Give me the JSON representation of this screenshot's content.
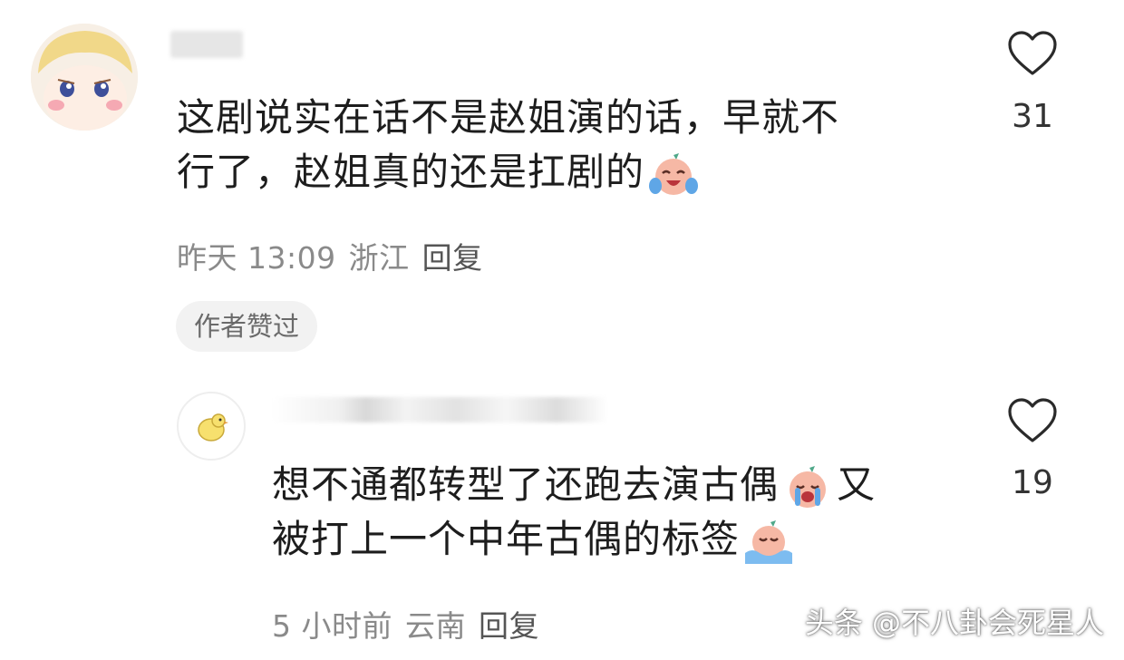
{
  "comments": [
    {
      "text_line1": "这剧说实在话不是赵姐演的话，早就不",
      "text_line2": "行了，赵姐真的还是扛剧的",
      "time": "昨天 13:09",
      "location": "浙江",
      "reply": "回复",
      "badge": "作者赞过",
      "likes": "31"
    },
    {
      "text_line1": "想不通都转型了还跑去演古偶",
      "text_line1_after": "又",
      "text_line2": "被打上一个中年古偶的标签",
      "time": "5 小时前",
      "location": "云南",
      "reply": "回复",
      "likes": "19"
    }
  ],
  "watermark": "头条 @不八卦会死星人",
  "icons": {
    "like": "heart-outline-icon",
    "emoji_laugh_cry": "laugh-cry-emoji-icon",
    "emoji_cry": "crying-emoji-icon",
    "emoji_tears": "tears-flood-emoji-icon"
  }
}
